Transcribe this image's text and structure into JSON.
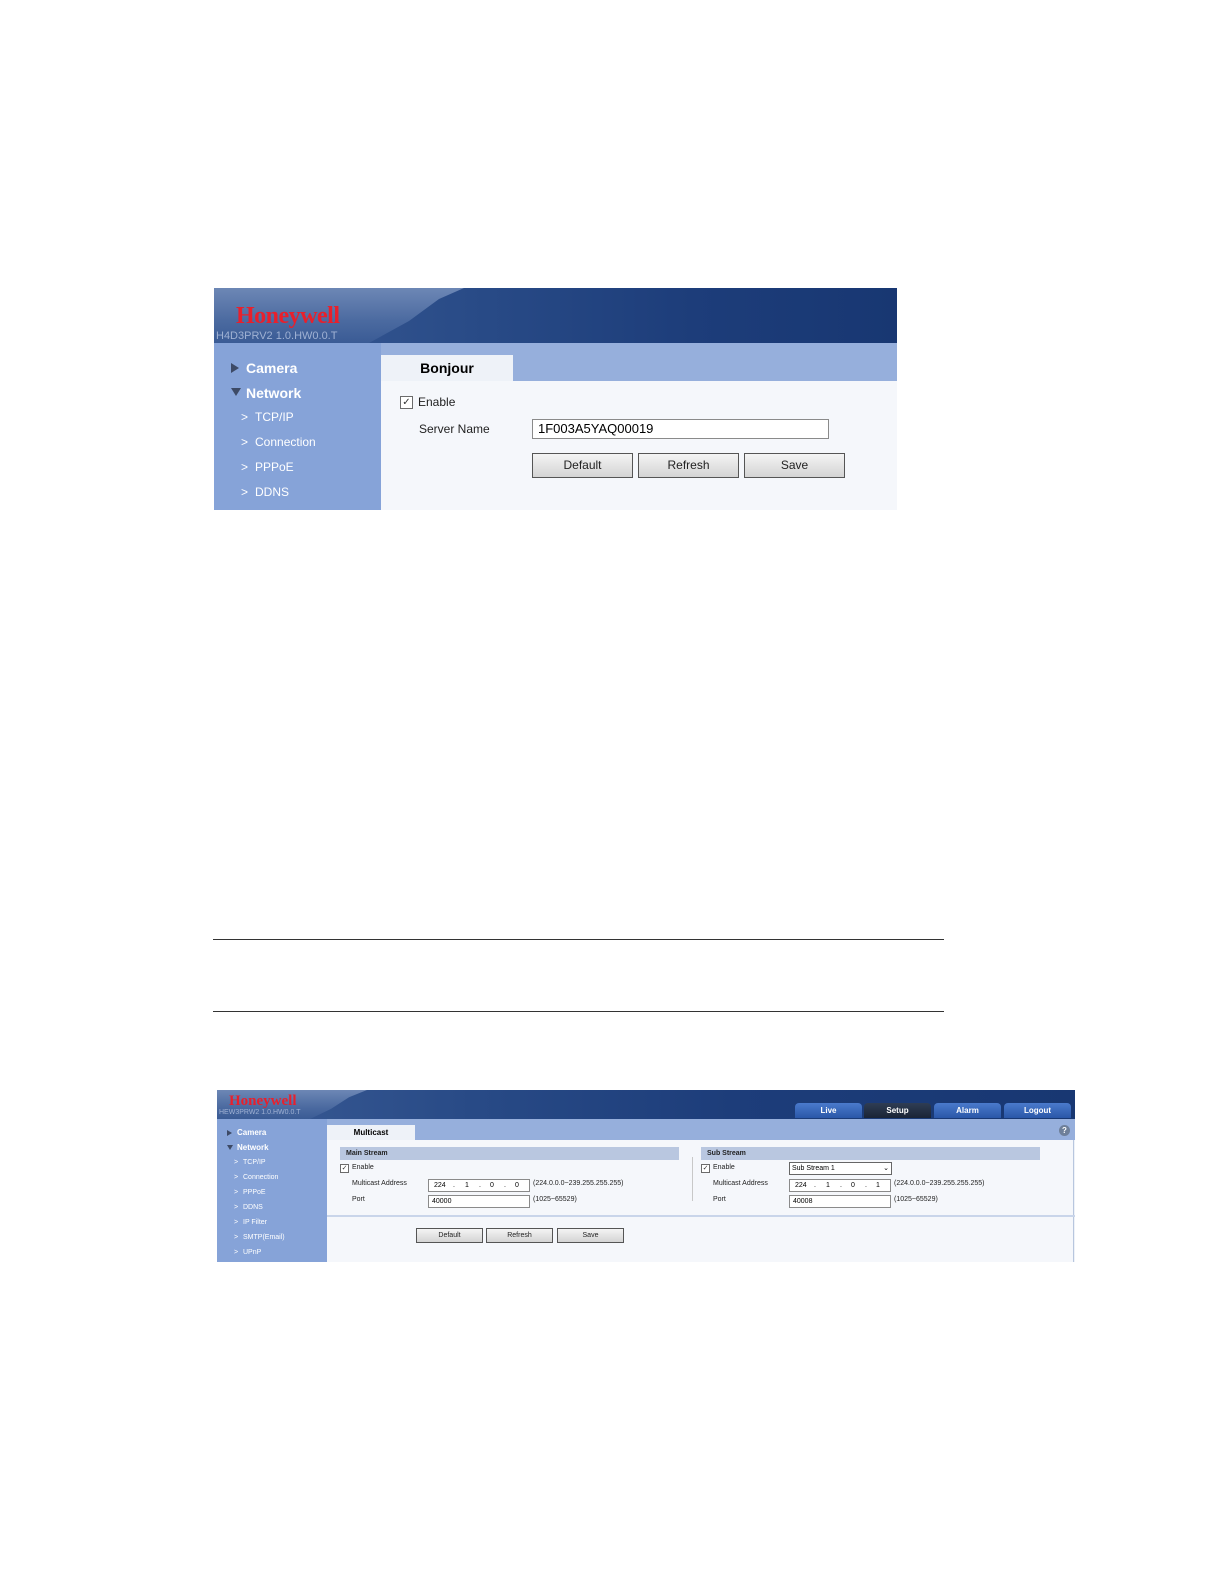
{
  "bonjour": {
    "brand": "Honeywell",
    "model": "H4D3PRV2   1.0.HW0.0.T",
    "sidebar": {
      "camera": "Camera",
      "network": "Network",
      "items": [
        "TCP/IP",
        "Connection",
        "PPPoE",
        "DDNS"
      ]
    },
    "tab": "Bonjour",
    "enable_label": "Enable",
    "enable_checked": true,
    "server_name_label": "Server Name",
    "server_name_value": "1F003A5YAQ00019",
    "buttons": {
      "default": "Default",
      "refresh": "Refresh",
      "save": "Save"
    }
  },
  "multicast": {
    "brand": "Honeywell",
    "model": "HEW3PRW2   1.0.HW0.0.T",
    "nav": {
      "live": "Live",
      "setup": "Setup",
      "alarm": "Alarm",
      "logout": "Logout",
      "active": "Setup"
    },
    "sidebar": {
      "camera": "Camera",
      "network": "Network",
      "items": [
        "TCP/IP",
        "Connection",
        "PPPoE",
        "DDNS",
        "IP Filter",
        "SMTP(Email)",
        "UPnP"
      ]
    },
    "tab": "Multicast",
    "help": "?",
    "main_stream": {
      "title": "Main Stream",
      "enable_label": "Enable",
      "enable_checked": true,
      "address_label": "Multicast Address",
      "address": [
        "224",
        "1",
        "0",
        "0"
      ],
      "address_range": "(224.0.0.0~239.255.255.255)",
      "port_label": "Port",
      "port": "40000",
      "port_range": "(1025~65529)"
    },
    "sub_stream": {
      "title": "Sub Stream",
      "enable_label": "Enable",
      "enable_checked": true,
      "stream_select": "Sub Stream 1",
      "address_label": "Multicast Address",
      "address": [
        "224",
        "1",
        "0",
        "1"
      ],
      "address_range": "(224.0.0.0~239.255.255.255)",
      "port_label": "Port",
      "port": "40008",
      "port_range": "(1025~65529)"
    },
    "buttons": {
      "default": "Default",
      "refresh": "Refresh",
      "save": "Save"
    }
  }
}
